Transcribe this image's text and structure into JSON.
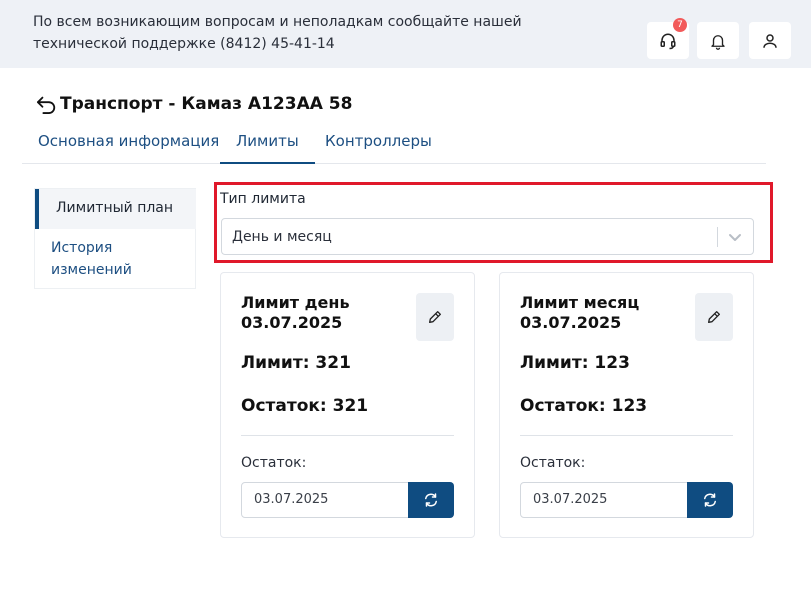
{
  "header": {
    "support_text": "По всем возникающим вопросам и неполадкам сообщайте нашей технической поддержке (8412) 45-41-14",
    "support_badge": "7"
  },
  "page": {
    "title": "Транспорт - Камаз А123АА 58"
  },
  "tabs": [
    {
      "label": "Основная информация"
    },
    {
      "label": "Лимиты"
    },
    {
      "label": "Контроллеры"
    }
  ],
  "sidebar": {
    "items": [
      {
        "label": "Лимитный план"
      },
      {
        "label": "История изменений"
      }
    ]
  },
  "limit_type": {
    "label": "Тип лимита",
    "value": "День и месяц"
  },
  "cards": [
    {
      "title": "Лимит день 03.07.2025",
      "limit": "Лимит: 321",
      "rest": "Остаток: 321",
      "rest_label": "Остаток:",
      "date_value": "03.07.2025"
    },
    {
      "title": "Лимит месяц 03.07.2025",
      "limit": "Лимит: 123",
      "rest": "Остаток: 123",
      "rest_label": "Остаток:",
      "date_value": "03.07.2025"
    }
  ],
  "colors": {
    "accent": "#0f4c81",
    "highlight": "#e0182a",
    "badge": "#f25a5a",
    "topbar": "#eef1f6"
  }
}
